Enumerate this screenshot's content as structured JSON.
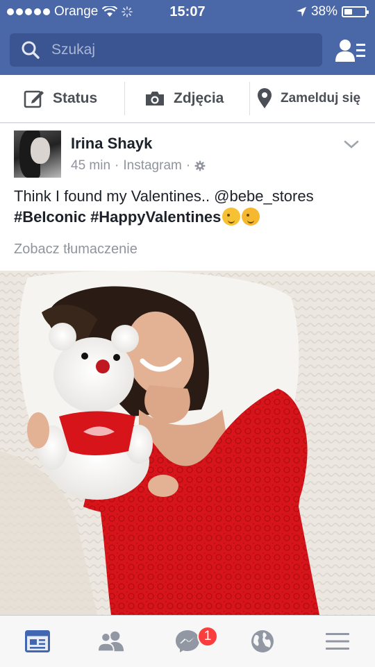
{
  "status_bar": {
    "carrier": "Orange",
    "time": "15:07",
    "battery": "38%",
    "battery_level": 0.38
  },
  "search": {
    "placeholder": "Szukaj"
  },
  "composer": {
    "status_label": "Status",
    "photos_label": "Zdjęcia",
    "checkin_label": "Zamelduj się"
  },
  "post": {
    "author": "Irina Shayk",
    "time": "45 min",
    "source": "Instagram",
    "text_line1": "Think I found my Valentines.. @bebe_stores",
    "hashtag1": "#BeIconic",
    "hashtag2": "#HappyValentines",
    "translate_label": "Zobacz tłumaczenie"
  },
  "tabbar": {
    "messages_badge": "1"
  },
  "colors": {
    "header": "#4a67a8",
    "search_bg": "#3b5592",
    "tab_active": "#4267b2",
    "tab_inactive": "#9197a3",
    "badge": "#fa3e3e",
    "dress": "#d7141a"
  },
  "icons": [
    "search-icon",
    "friend-requests-icon",
    "edit-icon",
    "camera-icon",
    "location-pin-icon",
    "chevron-down-icon",
    "settings-gear-icon",
    "news-feed-icon",
    "friends-icon",
    "messenger-icon",
    "globe-icon",
    "menu-icon"
  ]
}
